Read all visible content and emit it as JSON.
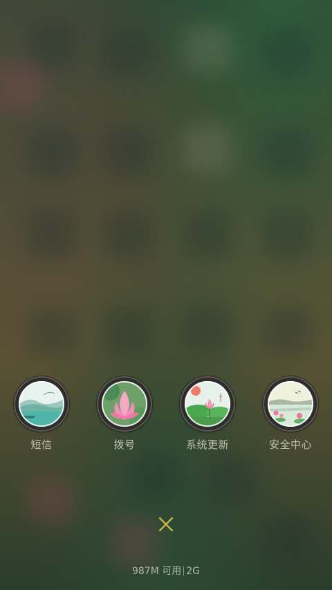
{
  "apps": [
    {
      "label": "短信",
      "icon": "messages-landscape-icon"
    },
    {
      "label": "拨号",
      "icon": "dialer-lotus-icon"
    },
    {
      "label": "系统更新",
      "icon": "system-update-lotus-pond-icon"
    },
    {
      "label": "安全中心",
      "icon": "security-center-lake-icon"
    }
  ],
  "close_icon": "close-icon",
  "status": {
    "memory": "987M 可用",
    "network": "2G"
  },
  "colors": {
    "close_icon": "#c8b84a",
    "label_text": "#ebe8dc"
  }
}
